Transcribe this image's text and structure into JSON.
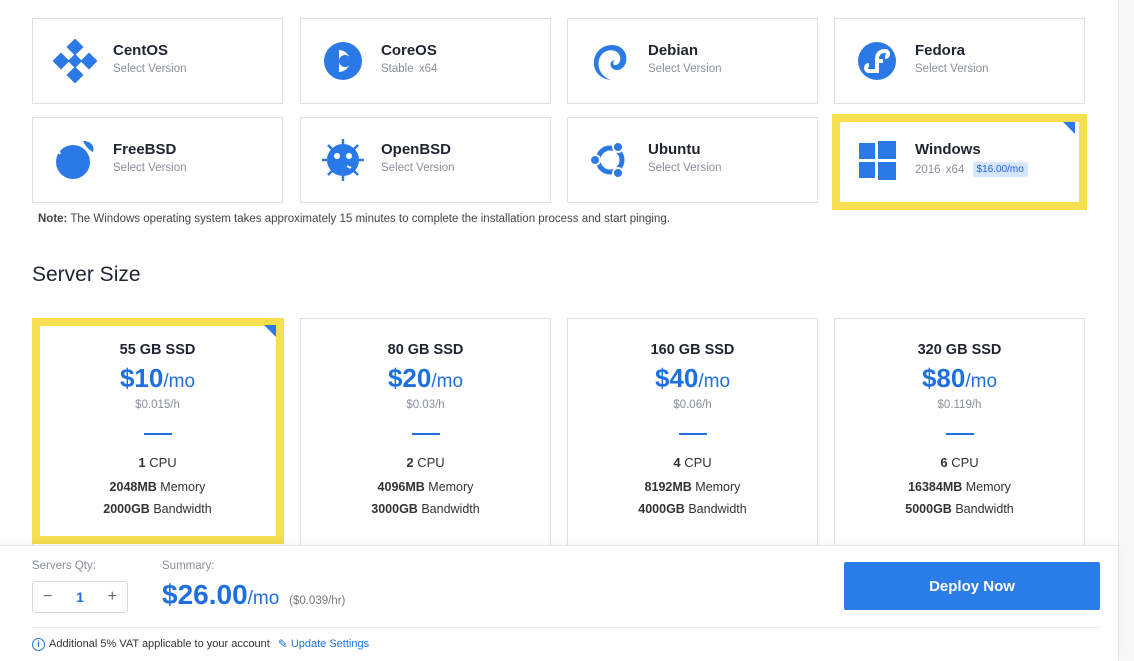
{
  "os_options": [
    {
      "name": "CentOS",
      "sub": "Select Version",
      "icon": "centos-icon"
    },
    {
      "name": "CoreOS",
      "sub_parts": [
        "Stable",
        "x64"
      ],
      "icon": "coreos-icon"
    },
    {
      "name": "Debian",
      "sub": "Select Version",
      "icon": "debian-icon"
    },
    {
      "name": "Fedora",
      "sub": "Select Version",
      "icon": "fedora-icon"
    },
    {
      "name": "FreeBSD",
      "sub": "Select Version",
      "icon": "freebsd-icon"
    },
    {
      "name": "OpenBSD",
      "sub": "Select Version",
      "icon": "openbsd-icon"
    },
    {
      "name": "Ubuntu",
      "sub": "Select Version",
      "icon": "ubuntu-icon"
    },
    {
      "name": "Windows",
      "sub_parts": [
        "2016",
        "x64"
      ],
      "price_badge": "$16.00/mo",
      "icon": "windows-icon",
      "selected": true
    }
  ],
  "note": {
    "label": "Note:",
    "text": "The Windows operating system takes approximately 15 minutes to complete the installation process and start pinging."
  },
  "server_size": {
    "title": "Server Size",
    "plans": [
      {
        "ssd": "55 GB SSD",
        "price": "$10",
        "per": "/mo",
        "hourly": "$0.015/h",
        "cpu": "1",
        "cpu_unit": "CPU",
        "memory": "2048MB",
        "memory_label": "Memory",
        "bandwidth": "2000GB",
        "bandwidth_label": "Bandwidth",
        "selected": true
      },
      {
        "ssd": "80 GB SSD",
        "price": "$20",
        "per": "/mo",
        "hourly": "$0.03/h",
        "cpu": "2",
        "cpu_unit": "CPU",
        "memory": "4096MB",
        "memory_label": "Memory",
        "bandwidth": "3000GB",
        "bandwidth_label": "Bandwidth"
      },
      {
        "ssd": "160 GB SSD",
        "price": "$40",
        "per": "/mo",
        "hourly": "$0.06/h",
        "cpu": "4",
        "cpu_unit": "CPU",
        "memory": "8192MB",
        "memory_label": "Memory",
        "bandwidth": "4000GB",
        "bandwidth_label": "Bandwidth"
      },
      {
        "ssd": "320 GB SSD",
        "price": "$80",
        "per": "/mo",
        "hourly": "$0.119/h",
        "cpu": "6",
        "cpu_unit": "CPU",
        "memory": "16384MB",
        "memory_label": "Memory",
        "bandwidth": "5000GB",
        "bandwidth_label": "Bandwidth"
      }
    ]
  },
  "footer": {
    "qty_label": "Servers Qty:",
    "qty_minus": "−",
    "qty_value": "1",
    "qty_plus": "+",
    "summary_label": "Summary:",
    "summary_price": "$26.00",
    "summary_per": "/mo",
    "summary_hourly": "($0.039/hr)",
    "deploy_label": "Deploy Now",
    "vat_text": "Additional 5% VAT applicable to your account",
    "update_link": "Update Settings"
  },
  "colors": {
    "accent": "#1e6fe0",
    "selection_highlight": "#f6df4f",
    "deploy_button": "#2a7ce8"
  }
}
